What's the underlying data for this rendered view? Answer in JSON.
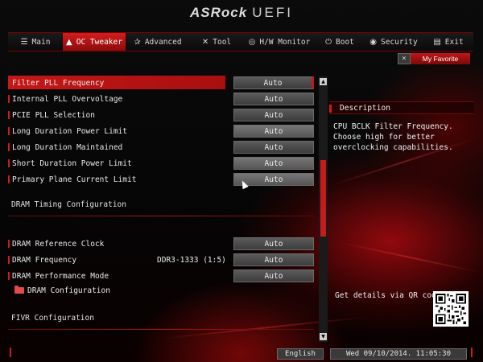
{
  "header": {
    "brand": "ASRock",
    "product": "UEFI"
  },
  "nav": {
    "tabs": [
      {
        "label": "Main",
        "icon": "list-icon",
        "glyph": "☰",
        "active": false
      },
      {
        "label": "OC Tweaker",
        "icon": "flame-icon",
        "glyph": "▲",
        "active": true
      },
      {
        "label": "Advanced",
        "icon": "star-icon",
        "glyph": "✰",
        "active": false
      },
      {
        "label": "Tool",
        "icon": "tools-icon",
        "glyph": "✕",
        "active": false
      },
      {
        "label": "H/W Monitor",
        "icon": "monitor-icon",
        "glyph": "◎",
        "active": false
      },
      {
        "label": "Boot",
        "icon": "power-icon",
        "glyph": "⏻",
        "active": false
      },
      {
        "label": "Security",
        "icon": "shield-icon",
        "glyph": "◉",
        "active": false
      },
      {
        "label": "Exit",
        "icon": "exit-icon",
        "glyph": "▤",
        "active": false
      }
    ]
  },
  "favorite": {
    "close": "×",
    "label": "My Favorite"
  },
  "settings": {
    "rows": [
      {
        "label": "Filter PLL Frequency",
        "value": "Auto"
      },
      {
        "label": "Internal PLL Overvoltage",
        "value": "Auto"
      },
      {
        "label": "PCIE PLL Selection",
        "value": "Auto"
      },
      {
        "label": "Long Duration Power Limit",
        "value": "Auto"
      },
      {
        "label": "Long Duration Maintained",
        "value": "Auto"
      },
      {
        "label": "Short Duration Power Limit",
        "value": "Auto"
      },
      {
        "label": "Primary Plane Current Limit",
        "value": "Auto"
      }
    ],
    "dram_section": "DRAM Timing Configuration",
    "dram_rows": [
      {
        "label": "DRAM Reference Clock",
        "value": "Auto",
        "info": ""
      },
      {
        "label": "DRAM Frequency",
        "value": "Auto",
        "info": "DDR3-1333 (1:5)"
      },
      {
        "label": "DRAM Performance Mode",
        "value": "Auto",
        "info": ""
      }
    ],
    "dram_config": "DRAM Configuration",
    "fivr_section": "FIVR Configuration"
  },
  "scrollbar": {
    "up": "▲",
    "down": "▼"
  },
  "description": {
    "title": "Description",
    "text": "CPU BCLK Filter Frequency. Choose high for better overclocking capabilities."
  },
  "qr": {
    "label": "Get details via QR code"
  },
  "footer": {
    "language": "English",
    "datetime": "Wed 09/10/2014. 11:05:30"
  },
  "colors": {
    "accent": "#c41717",
    "panel": "#3c3c3c"
  }
}
